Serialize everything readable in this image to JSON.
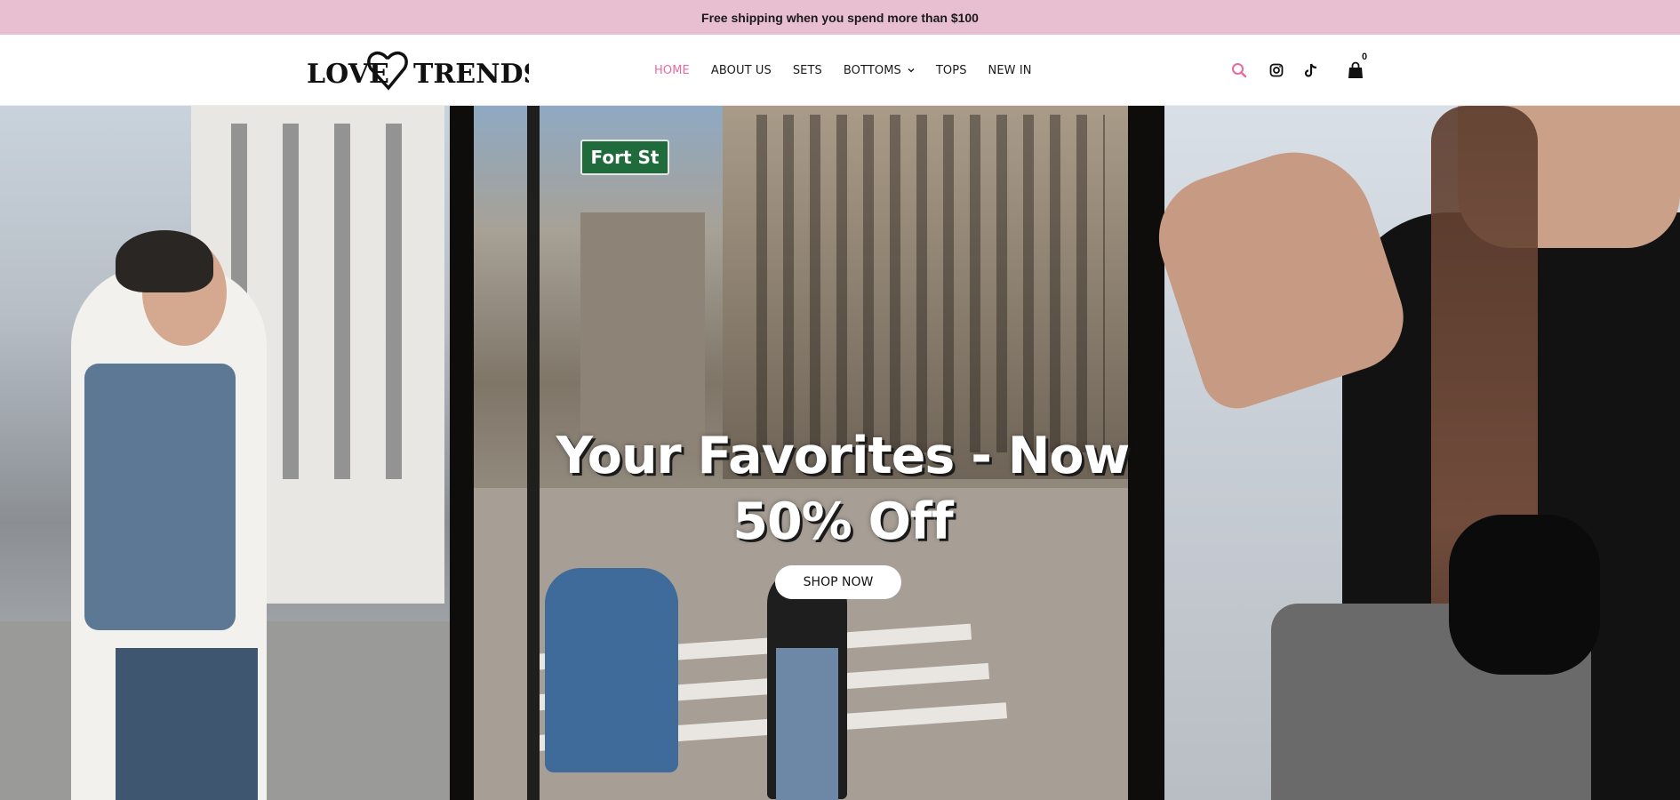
{
  "announcement": {
    "text": "Free shipping when you spend more than $100"
  },
  "brand": {
    "logo_text": "LOVE TRENDS",
    "accent_color": "#e86aa0",
    "bar_color": "#e8bfd0"
  },
  "nav": {
    "items": [
      {
        "label": "HOME",
        "active": true
      },
      {
        "label": "ABOUT US"
      },
      {
        "label": "SETS"
      },
      {
        "label": "BOTTOMS",
        "dropdown": true
      },
      {
        "label": "TOPS"
      },
      {
        "label": "NEW IN"
      }
    ]
  },
  "header_icons": {
    "search": "search-icon",
    "instagram": "instagram-icon",
    "tiktok": "tiktok-icon",
    "cart": "shopping-bag-icon",
    "cart_count": "0"
  },
  "hero": {
    "title_line1": "Your Favorites - Now",
    "title_line2": "50% Off",
    "cta_label": "SHOP NOW",
    "street_sign": "Fort St"
  }
}
